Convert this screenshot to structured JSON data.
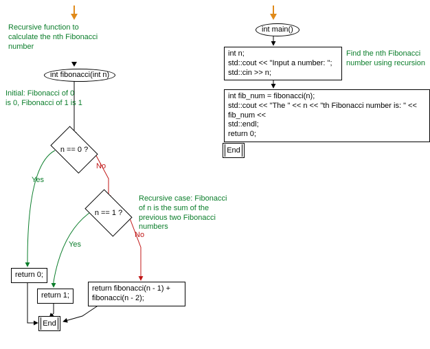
{
  "left": {
    "comment_top": "Recursive function to\ncalculate the nth Fibonacci\nnumber",
    "func_signature": "int fibonacci(int n)",
    "comment_base": "Initial: Fibonacci of 0\nis 0, Fibonacci of 1 is 1",
    "decision1": "n == 0 ?",
    "decision2": "n == 1 ?",
    "yes": "Yes",
    "no": "No",
    "return0": "return 0;",
    "return1": "return 1;",
    "rec_return": "return fibonacci(n - 1) +\nfibonacci(n - 2);",
    "comment_rec": "Recursive case: Fibonacci\nof n is the sum of the\nprevious two Fibonacci\nnumbers",
    "end": "End"
  },
  "right": {
    "func_signature": "int main()",
    "block1": "int n;\nstd::cout << \"Input a number: \";\nstd::cin >> n;",
    "comment": "Find the nth Fibonacci\nnumber using recursion",
    "block2": "int fib_num = fibonacci(n);\nstd::cout << \"The \" << n << \"th Fibonacci number is: \" << fib_num <<\nstd::endl;\nreturn 0;",
    "end": "End"
  },
  "chart_data": {
    "type": "flowchart",
    "functions": [
      {
        "name": "fibonacci",
        "signature": "int fibonacci(int n)",
        "description": "Recursive function to calculate the nth Fibonacci number",
        "nodes": [
          {
            "id": "start",
            "kind": "terminator",
            "label": "int fibonacci(int n)"
          },
          {
            "id": "d0",
            "kind": "decision",
            "label": "n == 0 ?",
            "note": "Initial: Fibonacci of 0 is 0, Fibonacci of 1 is 1"
          },
          {
            "id": "r0",
            "kind": "process",
            "label": "return 0;"
          },
          {
            "id": "d1",
            "kind": "decision",
            "label": "n == 1 ?"
          },
          {
            "id": "r1",
            "kind": "process",
            "label": "return 1;"
          },
          {
            "id": "rr",
            "kind": "process",
            "label": "return fibonacci(n - 1) + fibonacci(n - 2);",
            "note": "Recursive case: Fibonacci of n is the sum of the previous two Fibonacci numbers"
          },
          {
            "id": "end",
            "kind": "end",
            "label": "End"
          }
        ],
        "edges": [
          {
            "from": "start",
            "to": "d0"
          },
          {
            "from": "d0",
            "to": "r0",
            "label": "Yes"
          },
          {
            "from": "d0",
            "to": "d1",
            "label": "No"
          },
          {
            "from": "d1",
            "to": "r1",
            "label": "Yes"
          },
          {
            "from": "d1",
            "to": "rr",
            "label": "No"
          },
          {
            "from": "r0",
            "to": "end"
          },
          {
            "from": "r1",
            "to": "end"
          },
          {
            "from": "rr",
            "to": "end"
          }
        ]
      },
      {
        "name": "main",
        "signature": "int main()",
        "description": "Find the nth Fibonacci number using recursion",
        "nodes": [
          {
            "id": "mstart",
            "kind": "terminator",
            "label": "int main()"
          },
          {
            "id": "mb1",
            "kind": "process",
            "label": "int n;\nstd::cout << \"Input a number: \";\nstd::cin >> n;"
          },
          {
            "id": "mb2",
            "kind": "process",
            "label": "int fib_num = fibonacci(n);\nstd::cout << \"The \" << n << \"th Fibonacci number is: \" << fib_num << std::endl;\nreturn 0;"
          },
          {
            "id": "mend",
            "kind": "end",
            "label": "End"
          }
        ],
        "edges": [
          {
            "from": "mstart",
            "to": "mb1"
          },
          {
            "from": "mb1",
            "to": "mb2"
          },
          {
            "from": "mb2",
            "to": "mend"
          }
        ]
      }
    ]
  }
}
